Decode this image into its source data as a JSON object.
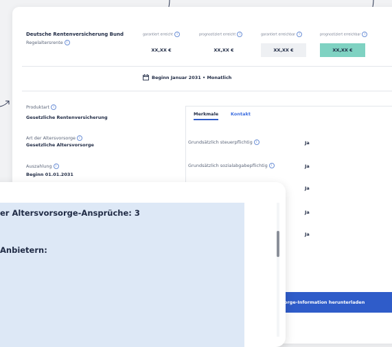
{
  "provider": {
    "name": "Deutsche Rentenversicherung Bund",
    "subtitle": "Regelaltersrente"
  },
  "value_columns": [
    {
      "label": "garantiert erreicht",
      "value": "XX,XX €",
      "highlight": "none"
    },
    {
      "label": "prognostiziert erreicht",
      "value": "XX,XX €",
      "highlight": "none"
    },
    {
      "label": "garantiert erreichbar",
      "value": "XX,XX €",
      "highlight": "grey"
    },
    {
      "label": "prognostiziert erreichbar",
      "value": "XX,XX €",
      "highlight": "teal"
    }
  ],
  "begin_text": "Beginn Januar 2031 • Monatlich",
  "details": [
    {
      "label": "Produktart",
      "value": "Gesetzliche Rentenversicherung"
    },
    {
      "label": "Art der Altersvorsorge",
      "value": "Gesetzliche Altersvorsorge"
    },
    {
      "label": "Auszahlung",
      "value": "Beginn 01.01.2031"
    }
  ],
  "tabs": [
    {
      "label": "Merkmale",
      "active": true
    },
    {
      "label": "Kontakt",
      "active": false
    }
  ],
  "features": [
    {
      "label": "Grundsätzlich steuerpflichtig",
      "value": "Ja"
    },
    {
      "label": "Grundsätzlich sozialabgabepflichtig",
      "value": "Ja"
    },
    {
      "label": "",
      "value": "Ja"
    },
    {
      "label": "",
      "value": "Ja"
    },
    {
      "label": "",
      "value": "Ja"
    }
  ],
  "download_label": "orge-Information herunterladen",
  "modal": {
    "title": "er Altersvorsorge-Ansprüche: 3",
    "subtitle": "Anbietern:"
  },
  "colors": {
    "accent": "#2f5cc9",
    "teal": "#7fd2c2",
    "modal_bg": "#dde8f6",
    "text": "#1f2a44"
  }
}
